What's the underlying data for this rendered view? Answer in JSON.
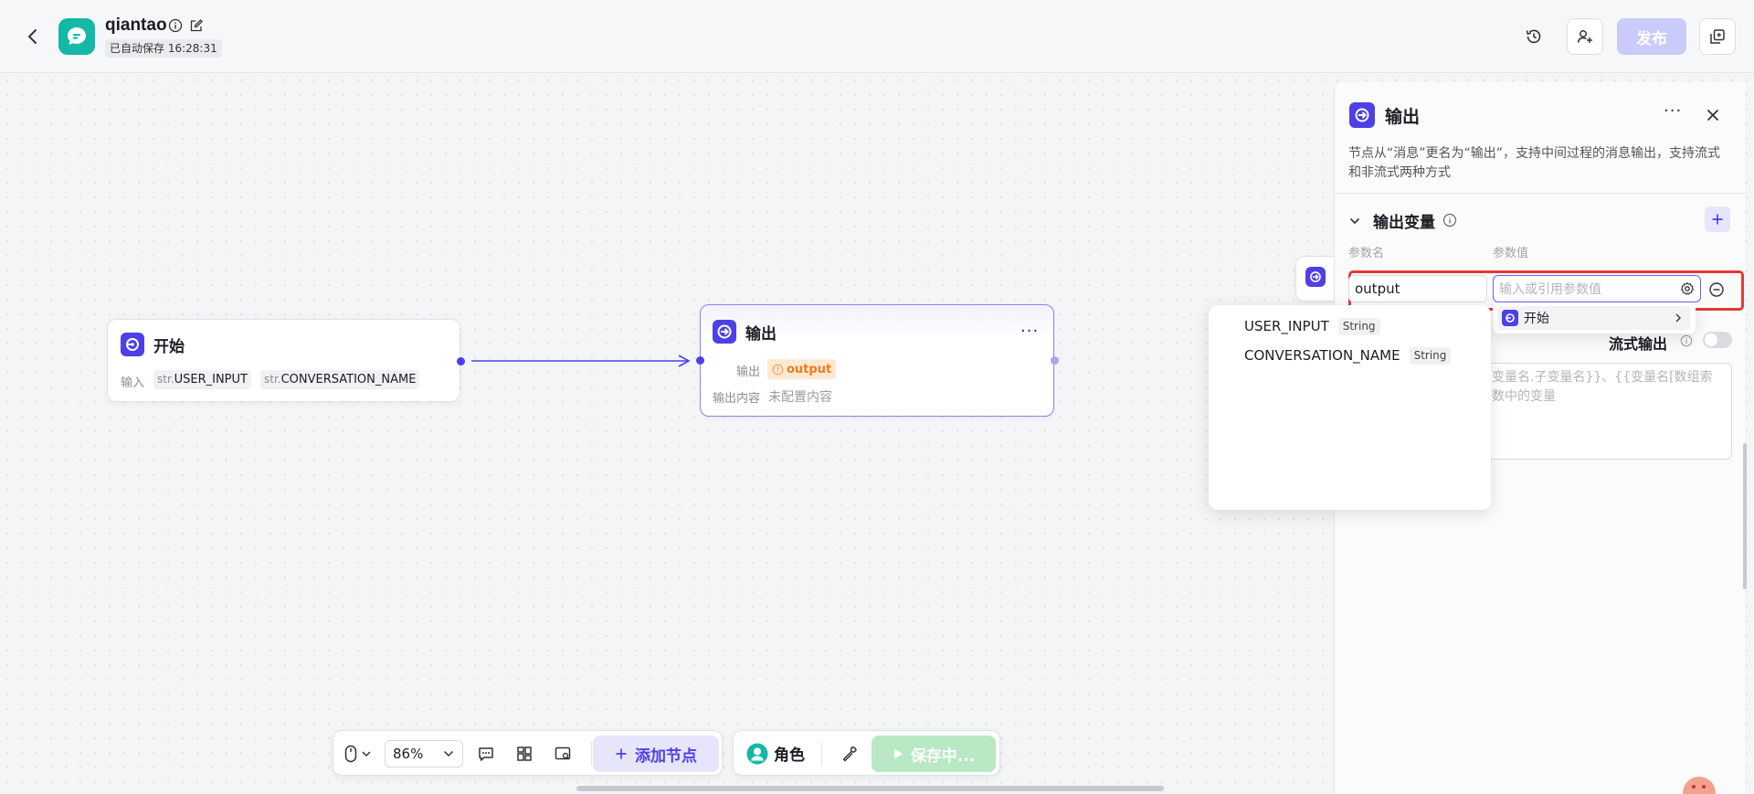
{
  "header": {
    "app_name": "qiantao",
    "autosave_status": "已自动保存 16:28:31",
    "publish_label": "发布"
  },
  "nodes": {
    "start": {
      "title": "开始",
      "input_label": "输入",
      "inputs": [
        {
          "prefix": "str.",
          "name": "USER_INPUT"
        },
        {
          "prefix": "str.",
          "name": "CONVERSATION_NAME"
        }
      ]
    },
    "output": {
      "title": "输出",
      "output_label": "输出",
      "output_var": "output",
      "content_label": "输出内容",
      "content_value": "未配置内容"
    }
  },
  "panel": {
    "title": "输出",
    "description": "节点从“消息”更名为“输出”，支持中间过程的消息输出，支持流式和非流式两种方式",
    "section_title": "输出变量",
    "param_name_header": "参数名",
    "param_value_header": "参数值",
    "param_name_value": "output",
    "param_value_placeholder": "输入或引用参数值",
    "stream_label": "流式输出",
    "content_placeholder_line1": "变量名.子变量名}}、{{变量名[数组索",
    "content_placeholder_line2": "数中的变量"
  },
  "ref_menu": {
    "node_item": "开始"
  },
  "var_menu": {
    "items": [
      {
        "name": "USER_INPUT",
        "type": "String"
      },
      {
        "name": "CONVERSATION_NAME",
        "type": "String"
      }
    ]
  },
  "toolbar": {
    "zoom": "86%",
    "add_node_label": "添加节点",
    "role_label": "角色",
    "save_label": "保存中..."
  },
  "colors": {
    "accent": "#4e40e5",
    "teal": "#14b8a6",
    "highlight_border": "#e53935",
    "output_tag_bg": "#ffe9d2",
    "output_tag_text": "#f07b1a",
    "save_button_bg": "#b8e8c4"
  }
}
